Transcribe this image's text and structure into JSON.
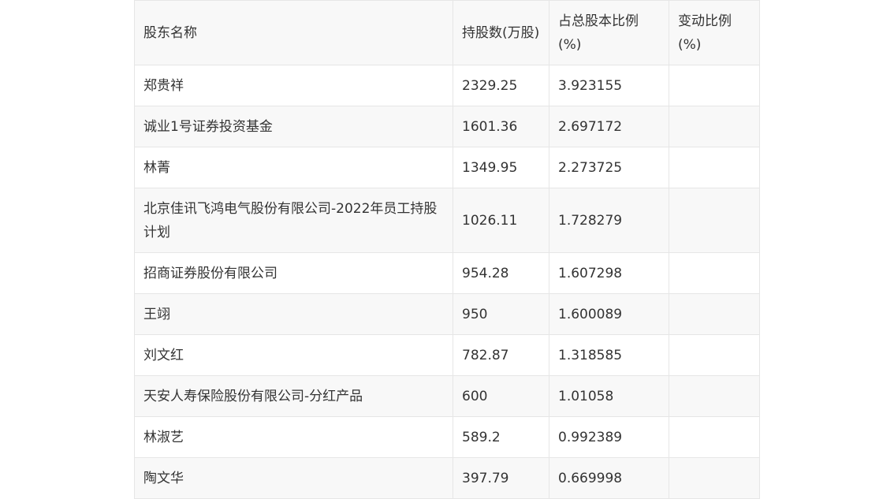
{
  "table": {
    "headers": [
      "股东名称",
      "持股数(万股)",
      "占总股本比例(%)",
      "变动比例(%)"
    ],
    "rows": [
      {
        "name": "郑贵祥",
        "shares": "2329.25",
        "ratio": "3.923155",
        "change": ""
      },
      {
        "name": "诚业1号证券投资基金",
        "shares": "1601.36",
        "ratio": "2.697172",
        "change": ""
      },
      {
        "name": "林菁",
        "shares": "1349.95",
        "ratio": "2.273725",
        "change": ""
      },
      {
        "name": "北京佳讯飞鸿电气股份有限公司-2022年员工持股计划",
        "shares": "1026.11",
        "ratio": "1.728279",
        "change": ""
      },
      {
        "name": "招商证券股份有限公司",
        "shares": "954.28",
        "ratio": "1.607298",
        "change": ""
      },
      {
        "name": "王翊",
        "shares": "950",
        "ratio": "1.600089",
        "change": ""
      },
      {
        "name": "刘文红",
        "shares": "782.87",
        "ratio": "1.318585",
        "change": ""
      },
      {
        "name": "天安人寿保险股份有限公司-分红产品",
        "shares": "600",
        "ratio": "1.01058",
        "change": ""
      },
      {
        "name": "林淑艺",
        "shares": "589.2",
        "ratio": "0.992389",
        "change": ""
      },
      {
        "name": "陶文华",
        "shares": "397.79",
        "ratio": "0.669998",
        "change": ""
      }
    ]
  }
}
